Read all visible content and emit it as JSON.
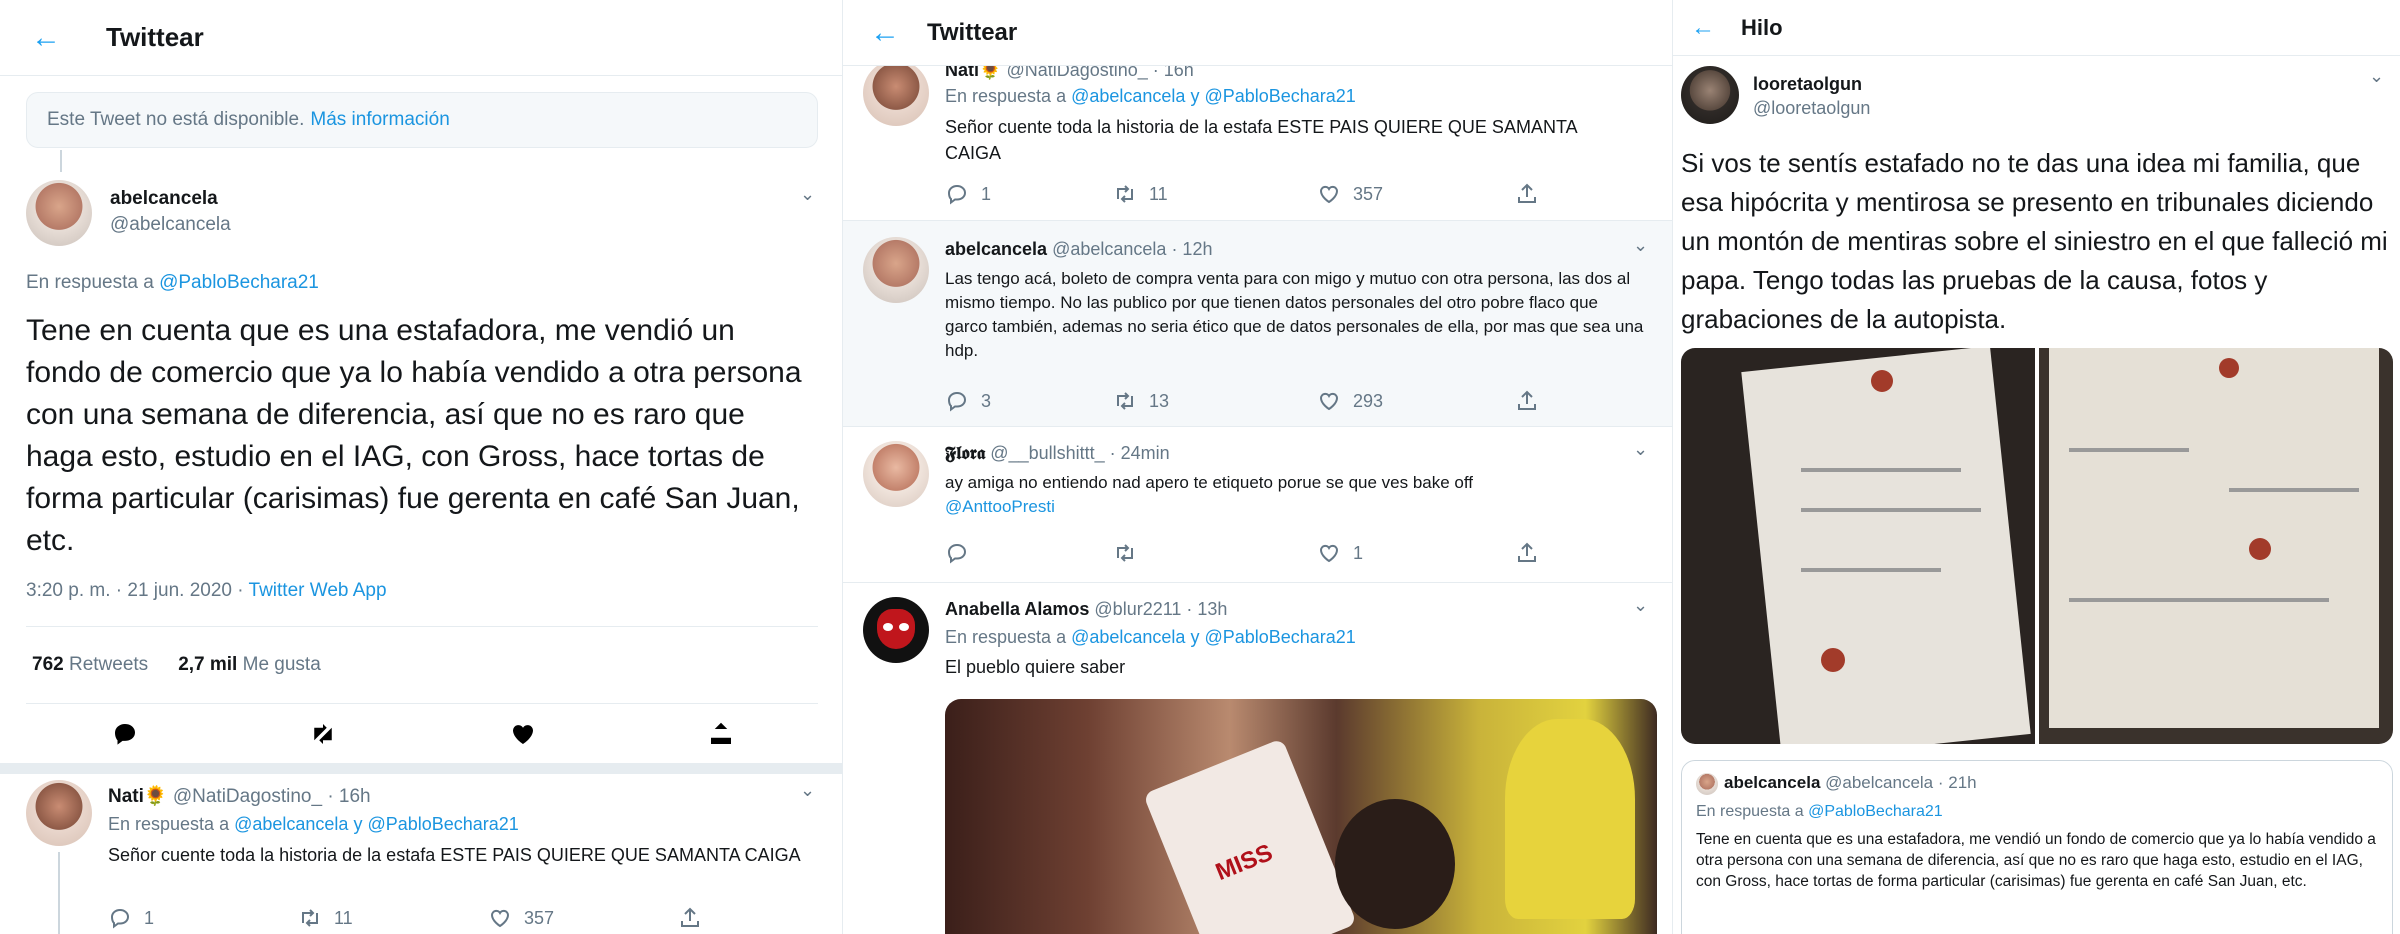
{
  "panel1": {
    "header_title": "Twittear",
    "unavailable_text": "Este Tweet no está disponible.",
    "more_info_link": "Más información",
    "main_tweet": {
      "display_name": "abelcancela",
      "handle": "@abelcancela",
      "reply_prefix": "En respuesta a",
      "reply_to": "@PabloBechara21",
      "text": "Tene en cuenta que es una estafadora, me vendió un fondo de comercio que ya lo había vendido a otra persona con una semana de diferencia, así que no es raro que haga esto, estudio en el IAG, con Gross, hace tortas de forma particular (carisimas) fue gerenta en café San Juan, etc.",
      "time_date": "3:20 p. m. · 21 jun. 2020 ·",
      "source": "Twitter Web App",
      "retweets_count": "762",
      "retweets_label": "Retweets",
      "likes_count": "2,7 mil",
      "likes_label": "Me gusta"
    },
    "reply": {
      "display_name": "Nati🌻",
      "handle_time": "@NatiDagostino_ · 16h",
      "reply_prefix": "En respuesta a",
      "reply_to": "@abelcancela y @PabloBechara21",
      "text": "Señor cuente toda la historia de la estafa ESTE PAIS QUIERE QUE SAMANTA CAIGA",
      "replies": "1",
      "retweets": "11",
      "likes": "357"
    }
  },
  "panel2": {
    "header_title": "Twittear",
    "top_reply": {
      "display_name": "Nati🌻",
      "handle_time": "@NatiDagostino_ · 16h",
      "reply_prefix": "En respuesta a",
      "reply_to": "@abelcancela y @PabloBechara21",
      "text": "Señor cuente toda la historia de la estafa ESTE PAIS QUIERE QUE SAMANTA CAIGA",
      "replies": "1",
      "retweets": "11",
      "likes": "357"
    },
    "abel_reply": {
      "display_name": "abelcancela",
      "handle_time": "@abelcancela · 12h",
      "text": "Las tengo acá, boleto de compra venta para con migo y mutuo con otra persona, las dos al mismo tiempo. No las publico por que tienen datos personales del otro pobre flaco que garco también, ademas no seria ético que de datos personales de ella, por mas que sea una hdp.",
      "replies": "3",
      "retweets": "13",
      "likes": "293"
    },
    "flora_reply": {
      "display_name": "𝕱𝖑𝖔𝖗𝖆",
      "handle_time": "@__bullshittt_ · 24min",
      "text": "ay amiga no entiendo nad apero te etiqueto porue se que ves bake off",
      "mention": "@AnttooPresti",
      "replies": "",
      "retweets": "",
      "likes": "1"
    },
    "anabella_reply": {
      "display_name": "Anabella Alamos",
      "handle_time": "@blur2211 · 13h",
      "reply_prefix": "En respuesta a",
      "reply_to": "@abelcancela y @PabloBechara21",
      "text": "El pueblo quiere saber",
      "gif_badge_text": "MISS"
    }
  },
  "panel3": {
    "header_title": "Hilo",
    "tweet": {
      "display_name": "looretaolgun",
      "handle": "@looretaolgun",
      "text": "Si vos te sentís estafado no te das una idea mi familia, que esa hipócrita y mentirosa se presento en tribunales diciendo un montón de mentiras sobre el siniestro en el que falleció mi papa. Tengo todas las pruebas de la causa, fotos y grabaciones de la autopista."
    },
    "quoted": {
      "display_name": "abelcancela",
      "handle_time": "@abelcancela · 21h",
      "reply_prefix": "En respuesta a",
      "reply_to": "@PabloBechara21",
      "text": "Tene en cuenta que es una estafadora, me vendió un fondo de comercio que ya lo había vendido a otra persona con una semana de diferencia, así que no es raro que haga esto, estudio en el IAG, con Gross, hace tortas de forma particular (carisimas) fue gerenta en café San Juan, etc."
    }
  },
  "colors": {
    "accent": "#1da1f2",
    "link": "#1b95e0",
    "muted": "#657786",
    "border": "#e6ecf0"
  },
  "icons": [
    "back-arrow-icon",
    "chevron-down-icon",
    "reply-icon",
    "retweet-icon",
    "like-icon",
    "share-icon"
  ]
}
